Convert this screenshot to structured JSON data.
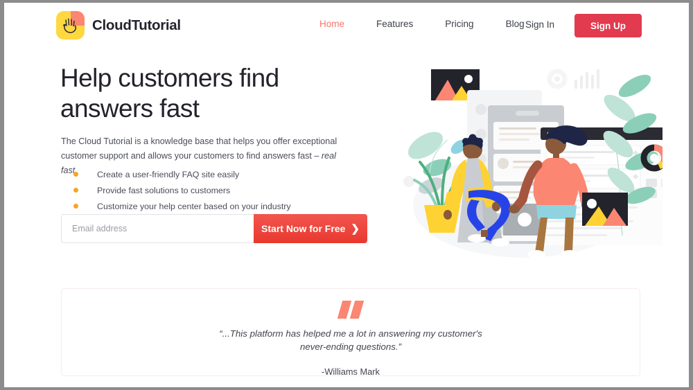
{
  "frame": {
    "border_color": "#8c8c8c"
  },
  "brand": {
    "name": "CloudTutorial",
    "logo_icon": "waving-hand-icon",
    "logo_bg_yellow": "#FFD740",
    "logo_bg_salmon": "#FB8672"
  },
  "nav": {
    "items": [
      {
        "label": "Home",
        "active": true
      },
      {
        "label": "Features",
        "active": false
      },
      {
        "label": "Pricing",
        "active": false
      },
      {
        "label": "Blog",
        "active": false
      }
    ],
    "sign_in_label": "Sign In",
    "sign_up_label": "Sign Up",
    "active_color": "#F4766A",
    "signup_bg": "#E23A4E"
  },
  "hero": {
    "title_line1": "Help customers find",
    "title_line2": "answers fast",
    "subtitle_plain": "The Cloud Tutorial is a knowledge base that helps you offer exceptional customer support and allows your customers to find answers fast – ",
    "subtitle_italic": "real fast.",
    "bullets": [
      "Create a user-friendly FAQ site easily",
      "Provide fast solutions to customers",
      "Customize your help center based on your industry"
    ],
    "bullet_color": "#F5A623",
    "email_placeholder": "Email address",
    "email_value": "",
    "cta_label": "Start Now for Free",
    "cta_icon": "chevron-right-icon",
    "cta_color": "#E8382F"
  },
  "illustration": {
    "name": "knowledge-base-hero-illustration",
    "alt": "Two people beside stacked help-center article cards, plants, image placeholders and chart icons",
    "colors": {
      "skin_dark": "#8A5A3B",
      "hair_navy": "#1F2546",
      "sweater_salmon": "#FB8672",
      "sweater_yellow": "#FFD233",
      "pants_blue": "#2743E8",
      "pants_tan": "#A8763F",
      "shorts_cyan": "#8FD3E0",
      "plant_green": "#8CCFB9",
      "plant_dark_green": "#4CAF7D",
      "card_gray": "#C9CDD2",
      "browser_bar_dark": "#2B2B33",
      "chart_black": "#22232b",
      "chart_orange": "#FB8672",
      "chart_yellow": "#FFD233"
    }
  },
  "testimonial": {
    "quote_icon": "quote-mark-icon",
    "quote_color": "#FB8672",
    "quote_line1": "“...This platform has helped me a lot in answering my customer's",
    "quote_line2": "never-ending questions.”",
    "author": "-Williams Mark"
  }
}
